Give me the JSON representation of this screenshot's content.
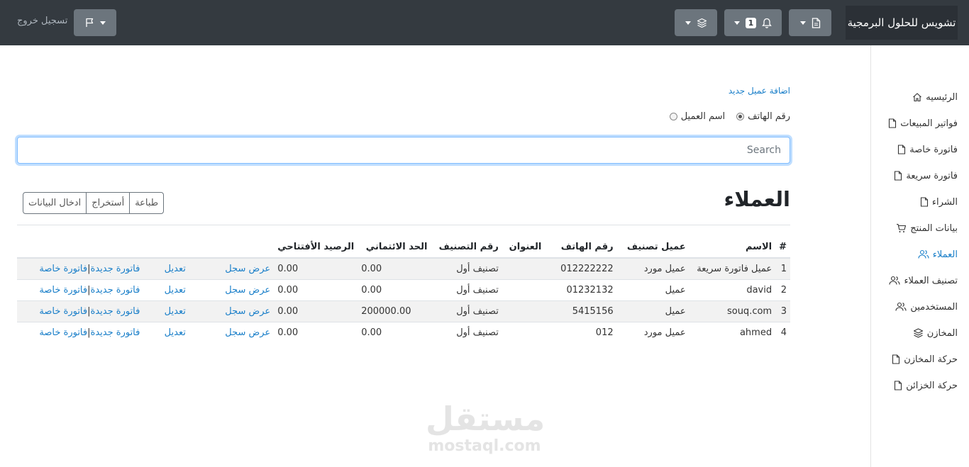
{
  "nav": {
    "brand": "تشويس للحلول البرمجية",
    "notification_count": "1",
    "logout": "تسجيل خروج"
  },
  "sidebar": {
    "items": [
      {
        "label": "الرئيسيه",
        "icon": "home-icon"
      },
      {
        "label": "فواتير المبيعات",
        "icon": "file-icon"
      },
      {
        "label": "فاتورة خاصة",
        "icon": "file-icon"
      },
      {
        "label": "فاتورة سريعة",
        "icon": "file-icon"
      },
      {
        "label": "الشراء",
        "icon": "file-icon"
      },
      {
        "label": "بيانات المنتج",
        "icon": "cart-icon"
      },
      {
        "label": "العملاء",
        "icon": "users-icon",
        "active": true
      },
      {
        "label": "تصنيف العملاء",
        "icon": "users-icon"
      },
      {
        "label": "المستخدمين",
        "icon": "users-icon"
      },
      {
        "label": "المخازن",
        "icon": "layers-icon"
      },
      {
        "label": "حركة المخازن",
        "icon": "file-icon"
      },
      {
        "label": "حركة الخزائن",
        "icon": "file-icon"
      }
    ]
  },
  "main": {
    "add_customer": "اضافة عميل جديد",
    "search_by": {
      "options": [
        "اسم العميل",
        "رقم الهاتف"
      ],
      "selected": "رقم الهاتف"
    },
    "search_placeholder": "Search",
    "title": "العملاء",
    "buttons": {
      "print": "طباعة",
      "export": "أستخراج",
      "import": "ادخال البيانات"
    },
    "table": {
      "headers": {
        "index": "#",
        "name": "الاسم",
        "type": "عميل تصنيف",
        "phone": "رقم الهاتف",
        "address": "العنوان",
        "class_no": "رقم التصنيف",
        "credit_limit": "الحد الائتماني",
        "opening_balance": "الرصيد الأفتتاحي"
      },
      "actions": {
        "view_log": "عرض سجل",
        "edit": "تعديل",
        "new_invoice": "فاتورة جديدة",
        "separator": "|",
        "special_invoice": "فاتورة خاصة"
      },
      "rows": [
        {
          "index": "1",
          "name": "عميل فاتورة سريعة",
          "type": "عميل مورد",
          "phone": "012222222",
          "address": "",
          "class_no": "تصنيف أول",
          "credit_limit": "0.00",
          "opening_balance": "0.00"
        },
        {
          "index": "2",
          "name": "david",
          "type": "عميل",
          "phone": "01232132",
          "address": "",
          "class_no": "تصنيف أول",
          "credit_limit": "0.00",
          "opening_balance": "0.00"
        },
        {
          "index": "3",
          "name": "souq.com",
          "type": "عميل",
          "phone": "5415156",
          "address": "",
          "class_no": "تصنيف أول",
          "credit_limit": "200000.00",
          "opening_balance": "0.00"
        },
        {
          "index": "4",
          "name": "ahmed",
          "type": "عميل مورد",
          "phone": "012",
          "address": "",
          "class_no": "تصنيف أول",
          "credit_limit": "0.00",
          "opening_balance": "0.00"
        }
      ]
    }
  },
  "watermark": {
    "arabic": "مستقل",
    "latin": "mostaql.com"
  }
}
